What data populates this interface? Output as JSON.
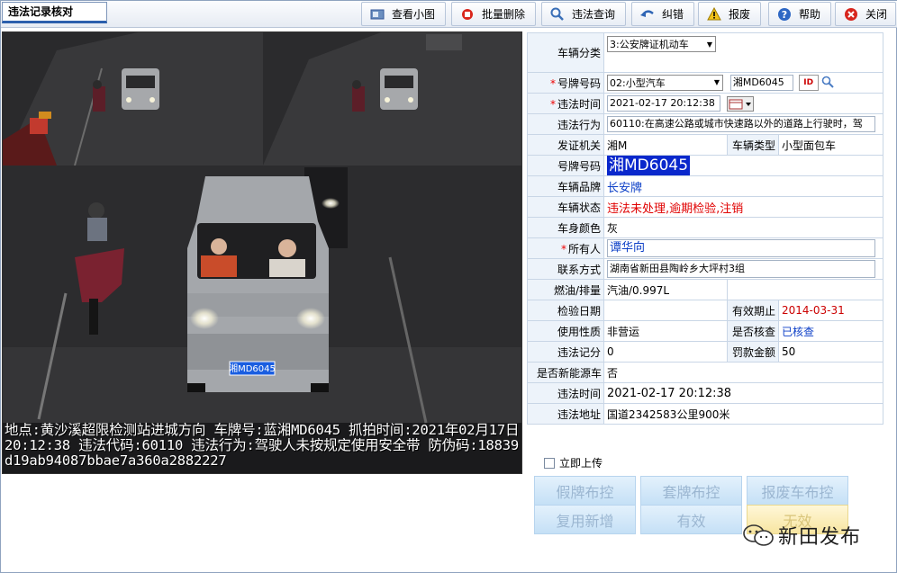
{
  "window_title": "违法记录核对",
  "toolbar": [
    {
      "label": "查看小图",
      "icon": "view-thumbnail-icon"
    },
    {
      "label": "批量删除",
      "icon": "delete-icon"
    },
    {
      "label": "违法查询",
      "icon": "search-icon"
    },
    {
      "label": "纠错",
      "icon": "undo-icon"
    },
    {
      "label": "报废",
      "icon": "warning-icon"
    },
    {
      "label": "帮助",
      "icon": "help-icon"
    },
    {
      "label": "关闭",
      "icon": "close-icon"
    }
  ],
  "photo": {
    "caption": "地点:黄沙溪超限检测站进城方向 车牌号:蓝湘MD6045 抓拍时间:2021年02月17日 20:12:38 违法代码:60110 违法行为:驾驶人未按规定使用安全带 防伪码:18839d19ab94087bbae7a360a2882227",
    "plate_text": "湘MD6045"
  },
  "form": {
    "vehicle_category": {
      "label": "车辆分类",
      "value": "3:公安牌证机动车"
    },
    "expand_glyph": "»",
    "plate_number": {
      "label": "号牌号码",
      "type": "02:小型汽车",
      "value": "湘MD6045"
    },
    "violation_time": {
      "label": "违法时间",
      "value": "2021-02-17 20:12:38"
    },
    "violation_act": {
      "label": "违法行为",
      "value": "60110:在高速公路或城市快速路以外的道路上行驶时，驾"
    },
    "issuing_authority": {
      "label": "发证机关",
      "value": "湘M"
    },
    "vehicle_type": {
      "label": "车辆类型",
      "value": "小型面包车"
    },
    "plate_number_display": {
      "label": "号牌号码",
      "value": "湘MD6045"
    },
    "vehicle_brand": {
      "label": "车辆品牌",
      "value": "长安牌"
    },
    "vehicle_status": {
      "label": "车辆状态",
      "value": "违法未处理,逾期检验,注销"
    },
    "body_color": {
      "label": "车身颜色",
      "value": "灰"
    },
    "owner": {
      "label": "所有人",
      "value": "谭华向"
    },
    "contact": {
      "label": "联系方式",
      "value": "湖南省新田县陶岭乡大坪村3组"
    },
    "fuel": {
      "label": "燃油/排量",
      "value": "汽油/0.997L"
    },
    "inspection_date": {
      "label": "检验日期",
      "value": ""
    },
    "valid_until": {
      "label": "有效期止",
      "value": "2014-03-31"
    },
    "use_nature": {
      "label": "使用性质",
      "value": "非营运"
    },
    "verified": {
      "label": "是否核查",
      "value": "已核查"
    },
    "points": {
      "label": "违法记分",
      "value": "0"
    },
    "fine": {
      "label": "罚款金额",
      "value": "50"
    },
    "new_energy": {
      "label": "是否新能源车",
      "value": "否"
    },
    "violation_time2": {
      "label": "违法时间",
      "value": "2021-02-17 20:12:38"
    },
    "violation_address": {
      "label": "违法地址",
      "value": "国道2342583公里900米"
    }
  },
  "upload_now": "立即上传",
  "bottom_buttons": [
    "假牌布控",
    "套牌布控",
    "报废车布控",
    "复用新增",
    "有效",
    "无效"
  ],
  "watermark": "新田发布",
  "colors": {
    "plate_highlight": "#0a28cc",
    "status_red": "#e00000",
    "brand_blue": "#0c3fc7"
  }
}
